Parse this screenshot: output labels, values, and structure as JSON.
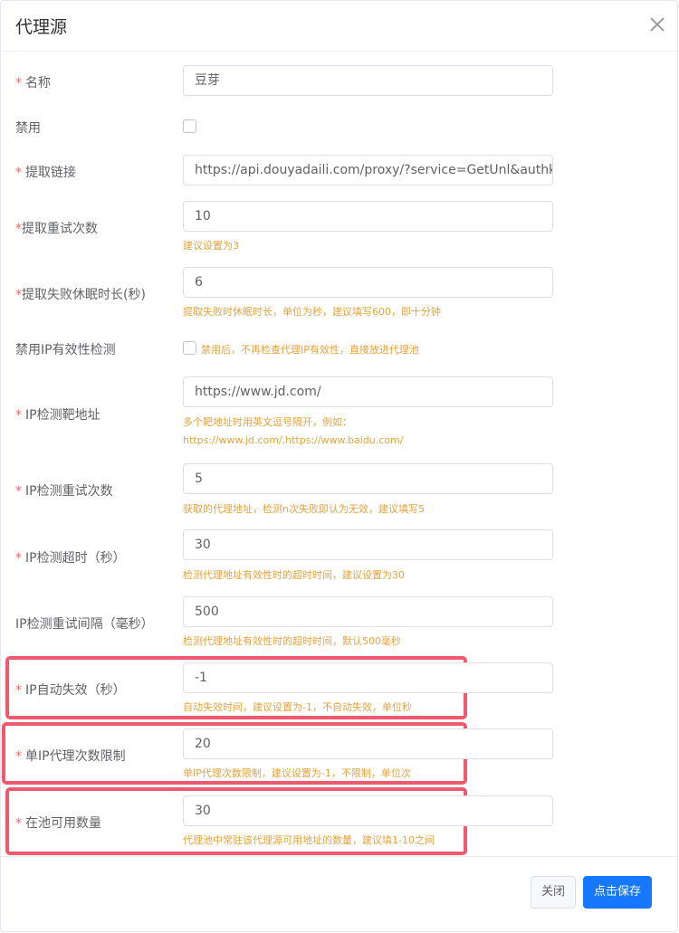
{
  "dialog": {
    "title": "代理源",
    "close_icon": "close-icon"
  },
  "form": {
    "name": {
      "label": "名称",
      "value": "豆芽"
    },
    "disable": {
      "label": "禁用",
      "checked": false
    },
    "extract_url": {
      "label": "提取链接",
      "value": "https://api.douyadaili.com/proxy/?service=GetUnl&authkey="
    },
    "retry_count": {
      "label": "提取重试次数",
      "value": "10",
      "hint": "建议设置为3"
    },
    "fail_sleep": {
      "label": "提取失败休眠时长(秒)",
      "value": "6",
      "hint": "提取失败时休眠时长，单位为秒，建议填写600，即十分钟"
    },
    "disable_ip_check": {
      "label": "禁用IP有效性检测",
      "checked": false,
      "hint": "禁用后，不再检查代理IP有效性，直接放进代理池"
    },
    "ip_check_target": {
      "label": "IP检测靶地址",
      "value": "https://www.jd.com/",
      "hint_line1": "多个靶地址时用英文逗号隔开，例如：",
      "hint_line2": "https://www.jd.com/,https://www.baidu.com/"
    },
    "ip_check_retry": {
      "label": "IP检测重试次数",
      "value": "5",
      "hint": "获取的代理地址，检测n次失败即认为无效，建议填写5"
    },
    "ip_check_timeout": {
      "label": "IP检测超时（秒）",
      "value": "30",
      "hint": "检测代理地址有效性时的超时时间，建议设置为30"
    },
    "ip_check_interval": {
      "label": "IP检测重试间隔（毫秒）",
      "value": "500",
      "hint": "检测代理地址有效性时的超时时间，默认500毫秒"
    },
    "ip_auto_expire": {
      "label": "IP自动失效（秒）",
      "value": "-1",
      "hint": "自动失效时间，建议设置为-1，不自动失效，单位秒"
    },
    "per_ip_limit": {
      "label": "单IP代理次数限制",
      "value": "20",
      "hint": "单IP代理次数限制，建议设置为-1，不限制，单位次"
    },
    "pool_size": {
      "label": "在池可用数量",
      "value": "30",
      "hint": "代理池中常驻该代理源可用地址的数量，建议填1-10之间"
    }
  },
  "required_mark": "*",
  "footer": {
    "cancel_label": "关闭",
    "save_label": "点击保存"
  },
  "colors": {
    "required": "#f56c6c",
    "hint": "#e6a23c",
    "highlight": "#f05a6e",
    "primary": "#1677ff"
  }
}
